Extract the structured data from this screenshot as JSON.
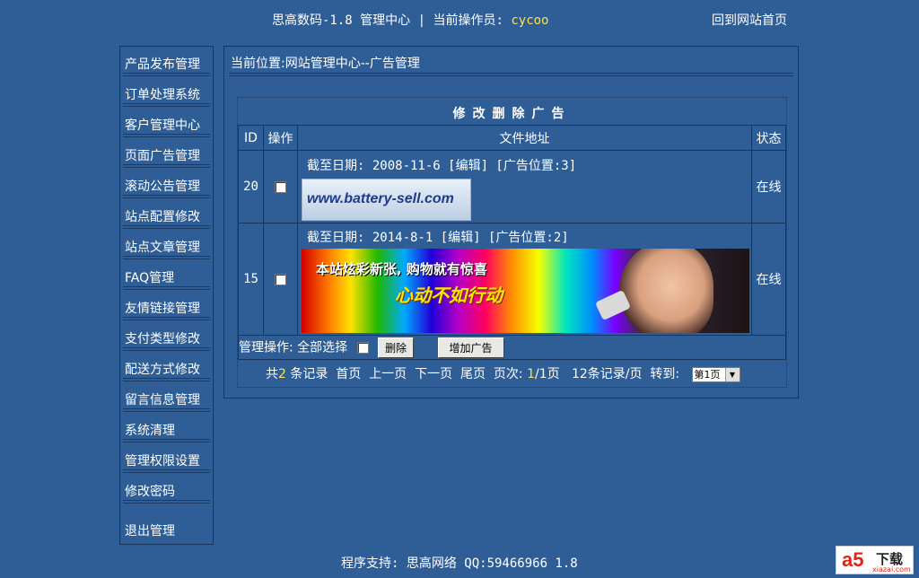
{
  "header": {
    "title": "思高数码-1.8 管理中心",
    "separator": "|",
    "operator_label": "当前操作员:",
    "operator": "cycoo",
    "home_link": "回到网站首页"
  },
  "sidebar": {
    "items": [
      "产品发布管理",
      "订单处理系统",
      "客户管理中心",
      "页面广告管理",
      "滚动公告管理",
      "站点配置修改",
      "站点文章管理",
      "FAQ管理",
      "友情链接管理",
      "支付类型修改",
      "配送方式修改",
      "留言信息管理",
      "系统清理",
      "管理权限设置",
      "修改密码"
    ],
    "logout": "退出管理"
  },
  "main": {
    "location": "当前位置:网站管理中心--广告管理",
    "table_title": "修改删除广告",
    "columns": [
      "ID",
      "操作",
      "文件地址",
      "状态"
    ],
    "rows": [
      {
        "id": "20",
        "info": "截至日期: 2008-11-6 [编辑] [广告位置:3]",
        "banner_text": "www.battery-sell.com",
        "status": "在线"
      },
      {
        "id": "15",
        "info": "截至日期: 2014-8-1 [编辑] [广告位置:2]",
        "banner_line1": "本站炫彩新张, 购物就有惊喜",
        "banner_line2": "心动不如行动",
        "status": "在线"
      }
    ],
    "ops_label": "管理操作:",
    "select_all": "全部选择",
    "delete_btn": "删除",
    "add_btn": "增加广告",
    "pager": {
      "total_prefix": "共",
      "total": "2",
      "total_suffix": " 条记录",
      "first": "首页",
      "prev": "上一页",
      "next": "下一页",
      "last": "尾页",
      "pages_label": "页次:",
      "current": "1",
      "pages_total": "/1页",
      "per_page": "12条记录/页",
      "goto_label": "转到:",
      "select_value": "第1页"
    }
  },
  "footer": {
    "text": "程序支持: 思高网络 QQ:59466966 1.8"
  },
  "logo": {
    "brand": "a5",
    "label": "下载",
    "domain": "xiazai.com"
  }
}
